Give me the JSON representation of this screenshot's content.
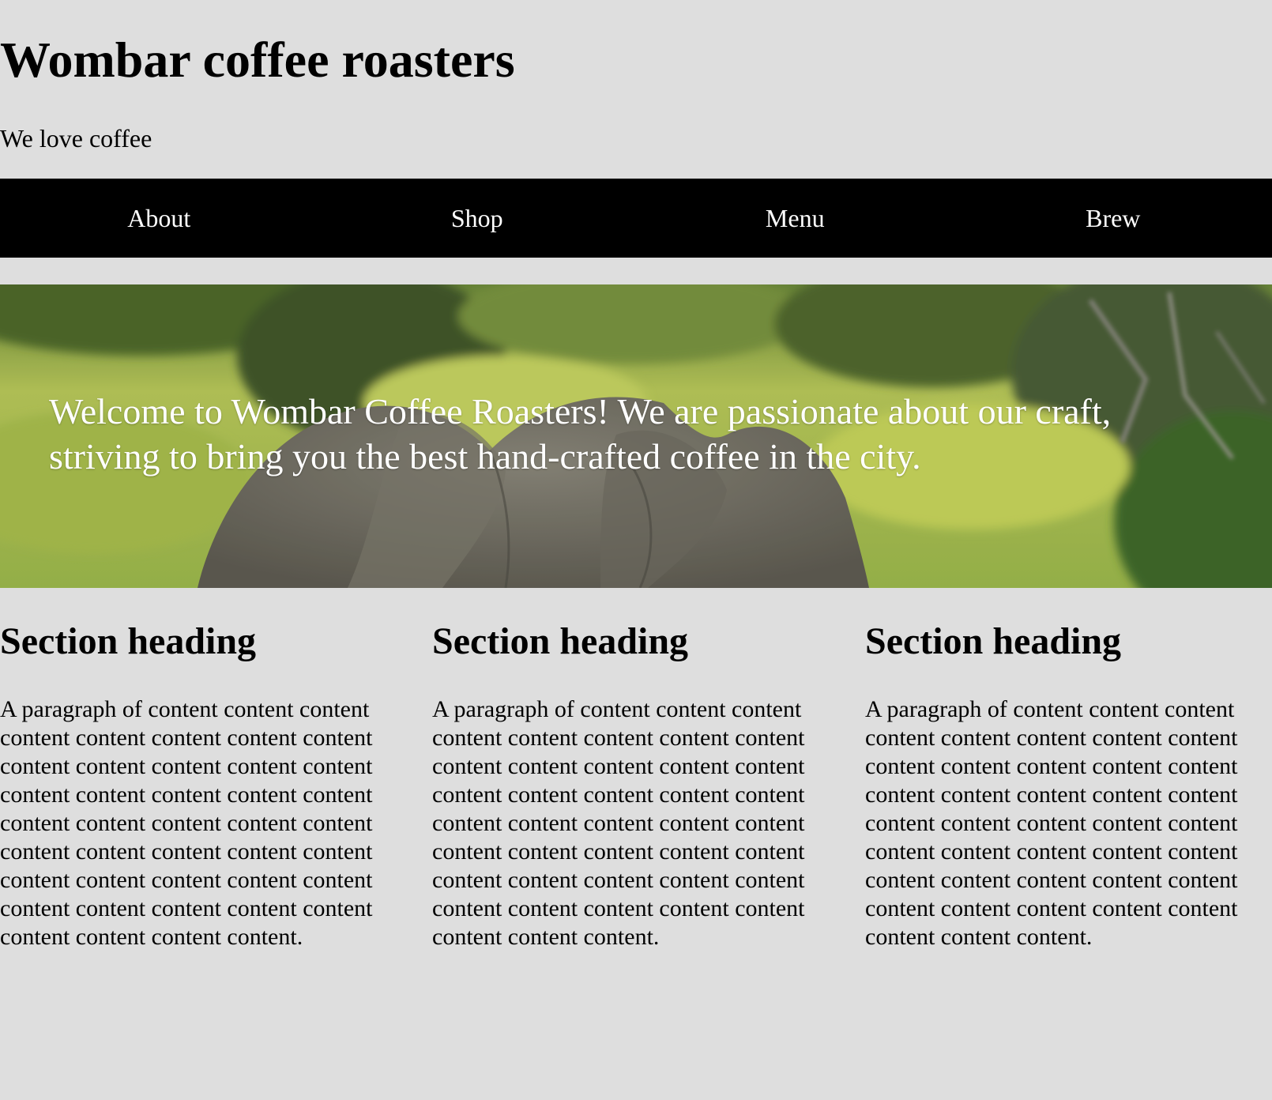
{
  "header": {
    "title": "Wombar coffee roasters",
    "tagline": "We love coffee"
  },
  "nav": {
    "items": [
      {
        "label": "About"
      },
      {
        "label": "Shop"
      },
      {
        "label": "Menu"
      },
      {
        "label": "Brew"
      }
    ]
  },
  "hero": {
    "image": "elephant-in-green-field",
    "text": "Welcome to Wombar Coffee Roasters! We are passionate about our craft, striving to bring you the best hand-crafted coffee in the city."
  },
  "sections": [
    {
      "heading": "Section heading",
      "body": "A paragraph of content content content content content content content content content content content content content content content content content content content content content content content content content content content content content content content content content content content content content content content content content content."
    },
    {
      "heading": "Section heading",
      "body": "A paragraph of content content content content content content content content content content content content content content content content content content content content content content content content content content content content content content content content content content content content content content content content content."
    },
    {
      "heading": "Section heading",
      "body": "A paragraph of content content content content content content content content content content content content content content content content content content content content content content content content content content content content content content content content content content content content content content content content content."
    }
  ],
  "colors": {
    "page_background": "#dedede",
    "nav_background": "#000000",
    "nav_text": "#ffffff",
    "hero_text": "#ffffff"
  }
}
